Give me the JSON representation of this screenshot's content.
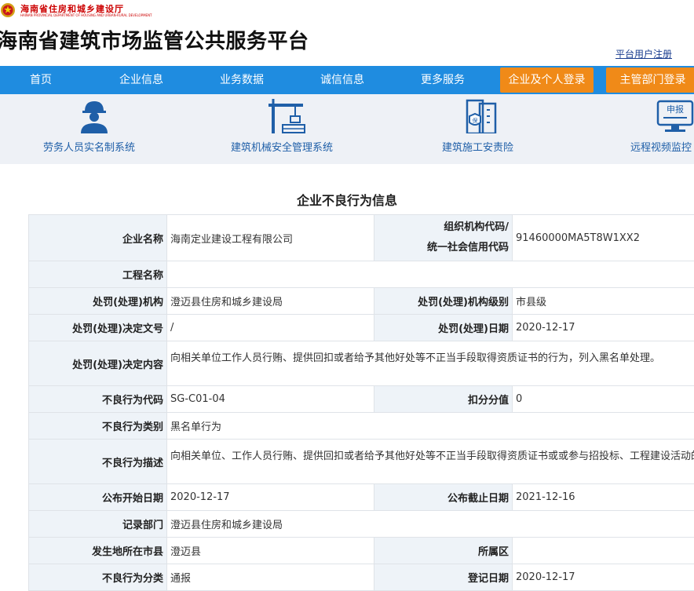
{
  "header": {
    "dept_cn": "海南省住房和城乡建设厅",
    "dept_en": "HAINAN PROVINCIAL DEPARTMENT OF HOUSING AND URBAN-RURAL DEVELOPMENT",
    "site_title": "海南省建筑市场监管公共服务平台",
    "register_link": "平台用户注册"
  },
  "nav": {
    "items": [
      "首页",
      "企业信息",
      "业务数据",
      "诚信信息",
      "更多服务"
    ],
    "login_company": "企业及个人登录",
    "login_authority": "主管部门登录"
  },
  "services": [
    {
      "label": "劳务人员实名制系统",
      "icon": "worker-icon"
    },
    {
      "label": "建筑机械安全管理系统",
      "icon": "crane-icon"
    },
    {
      "label": "建筑施工安责险",
      "icon": "insurance-building-icon"
    },
    {
      "label": "远程视频监控",
      "icon": "report-monitor-icon",
      "icon_text": "申报"
    }
  ],
  "page_title": "企业不良行为信息",
  "record": {
    "company_name_label": "企业名称",
    "company_name": "海南定业建设工程有限公司",
    "org_code_label_1": "组织机构代码/",
    "org_code_label_2": "统一社会信用代码",
    "org_code": "91460000MA5T8W1XX2",
    "project_name_label": "工程名称",
    "project_name": "",
    "authority_label": "处罚(处理)机构",
    "authority": "澄迈县住房和城乡建设局",
    "authority_level_label": "处罚(处理)机构级别",
    "authority_level": "市县级",
    "doc_no_label": "处罚(处理)决定文号",
    "doc_no": "/",
    "decision_date_label": "处罚(处理)日期",
    "decision_date": "2020-12-17",
    "decision_content_label": "处罚(处理)决定内容",
    "decision_content": "向相关单位工作人员行贿、提供回扣或者给予其他好处等不正当手段取得资质证书的行为，列入黑名单处理。",
    "behavior_code_label": "不良行为代码",
    "behavior_code": "SG-C01-04",
    "deduction_label": "扣分分值",
    "deduction": "0",
    "behavior_type_label": "不良行为类别",
    "behavior_type": "黑名单行为",
    "behavior_desc_label": "不良行为描述",
    "behavior_desc": "向相关单位、工作人员行贿、提供回扣或者给予其他好处等不正当手段取得资质证书或或参与招投标、工程建设活动的",
    "publish_start_label": "公布开始日期",
    "publish_start": "2020-12-17",
    "publish_end_label": "公布截止日期",
    "publish_end": "2021-12-16",
    "record_dept_label": "记录部门",
    "record_dept": "澄迈县住房和城乡建设局",
    "city_label": "发生地所在市县",
    "city": "澄迈县",
    "district_label": "所属区",
    "district": "",
    "category_label": "不良行为分类",
    "category": "通报",
    "register_date_label": "登记日期",
    "register_date": "2020-12-17"
  }
}
